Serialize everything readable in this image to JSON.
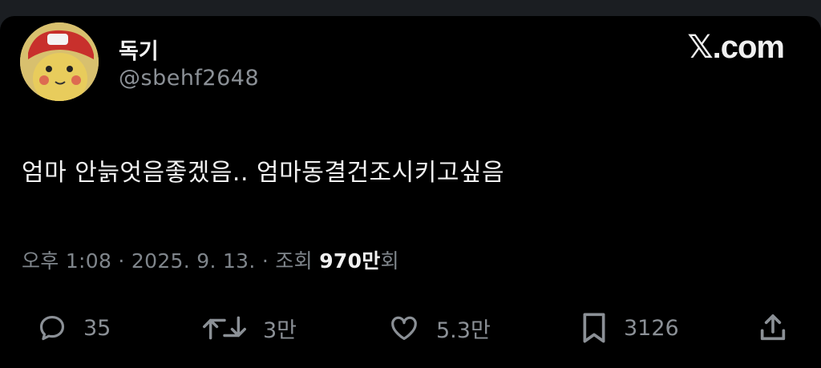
{
  "user": {
    "display_name": "독기",
    "handle": "@sbehf2648"
  },
  "brand": {
    "x_glyph": "𝕏",
    "domain": ".com"
  },
  "tweet": {
    "text": "엄마 안늙엇음좋겠음.. 엄마동결건조시키고싶음"
  },
  "meta": {
    "time_date": "오후 1:08 · 2025. 9. 13. · 조회 ",
    "views_count": "970만",
    "views_suffix": "회"
  },
  "actions": {
    "replies": "35",
    "retweets": "3만",
    "likes": "5.3만",
    "bookmarks": "3126"
  },
  "colors": {
    "background": "#000000",
    "text": "#e7e9ea",
    "muted": "#8b9096"
  },
  "icons": [
    "reply-icon",
    "retweet-icon",
    "like-icon",
    "bookmark-icon",
    "share-icon"
  ]
}
